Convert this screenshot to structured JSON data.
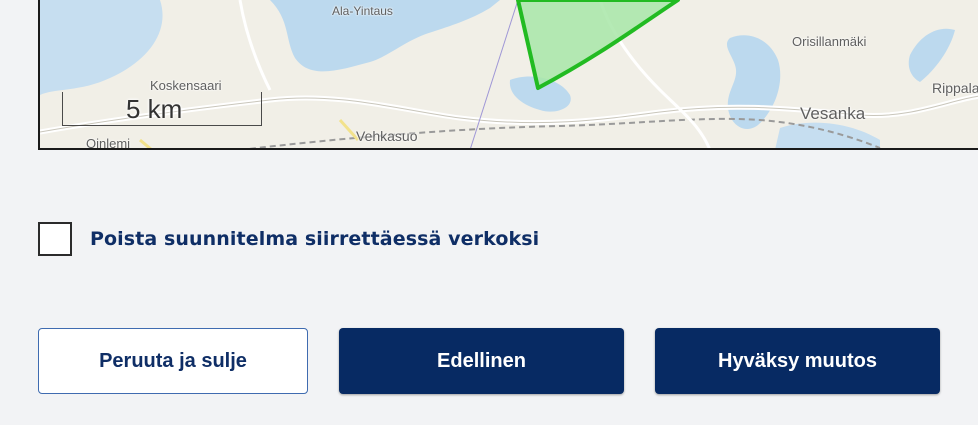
{
  "map": {
    "scale_label": "5 km",
    "place_labels": [
      "Koskensaari",
      "Oinlemi",
      "Vehkasuo",
      "Orisillanmäki",
      "Vesanka",
      "Rippala",
      "Ala-Yintaus"
    ],
    "colors": {
      "water": "#bcd9ee",
      "land": "#f1efe7",
      "area_fill": "#a8e6a8",
      "area_stroke": "#22bb22"
    }
  },
  "options": {
    "remove_plan_label": "Poista suunnitelma siirrettäessä verkoksi",
    "remove_plan_checked": false
  },
  "buttons": {
    "cancel_label": "Peruuta ja sulje",
    "previous_label": "Edellinen",
    "accept_label": "Hyväksy muutos"
  }
}
